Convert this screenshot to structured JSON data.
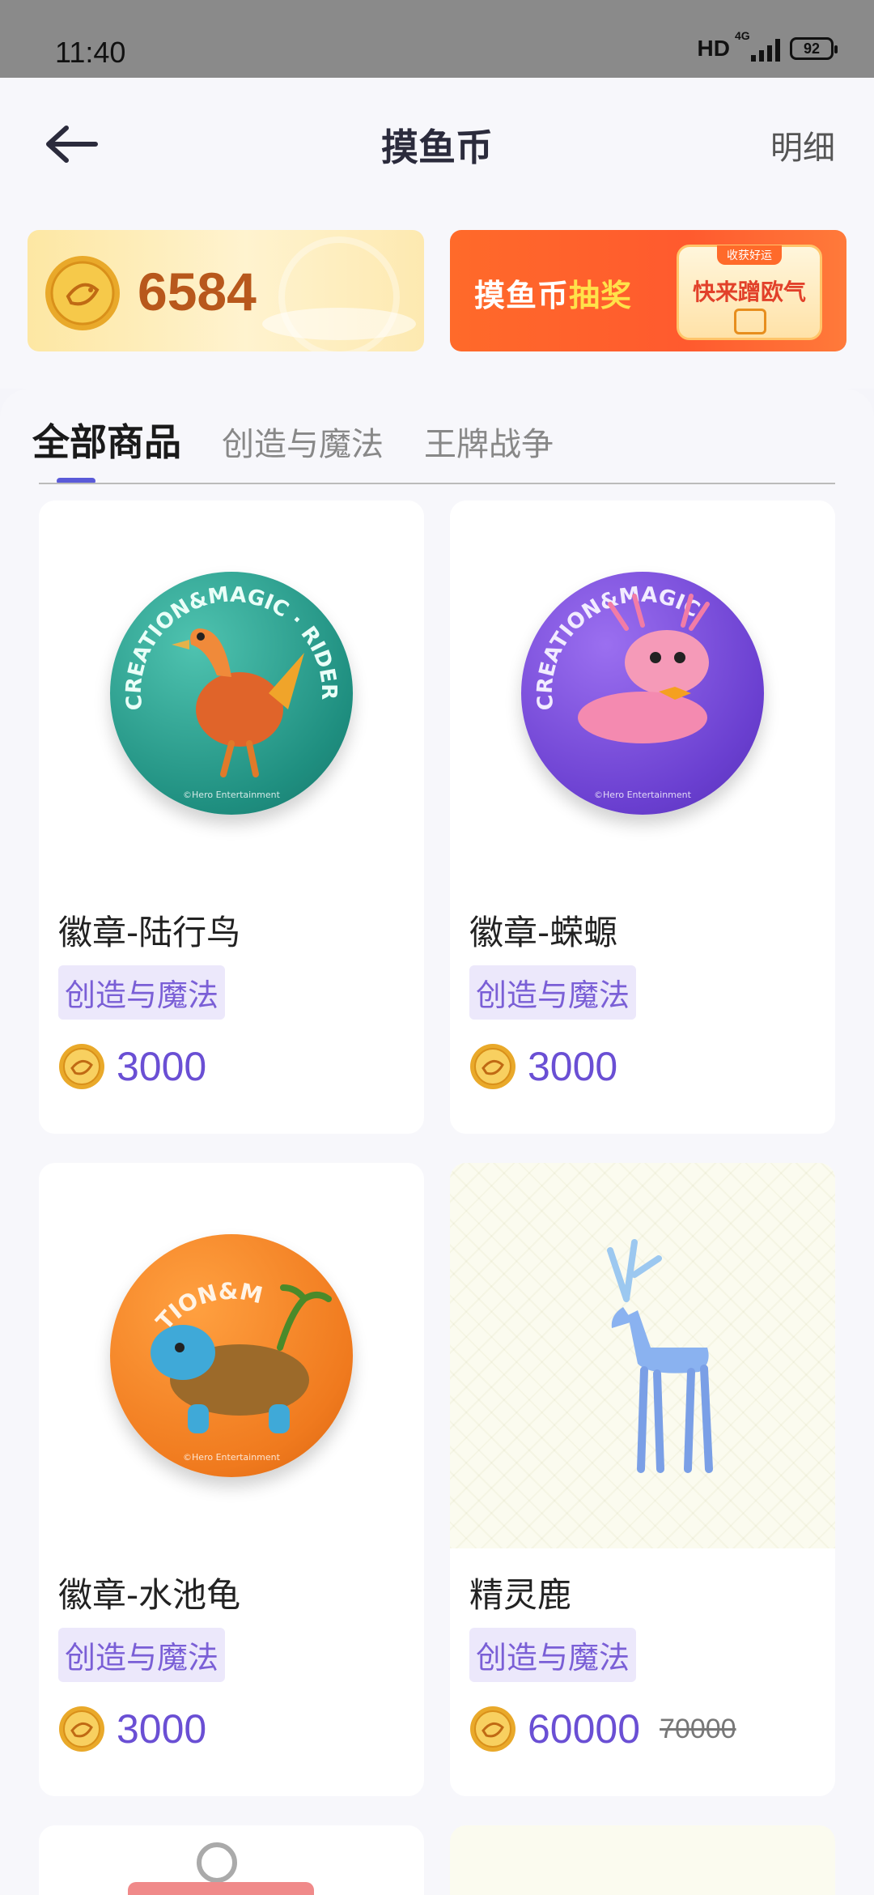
{
  "status_bar": {
    "time": "11:40",
    "hd": "HD",
    "network": "4G",
    "battery": "92"
  },
  "header": {
    "title": "摸鱼币",
    "detail_label": "明细"
  },
  "coin": {
    "balance": "6584"
  },
  "lottery": {
    "text_part1": "摸鱼币",
    "text_part2": "抽奖",
    "badge_top": "收获好运",
    "badge_main": "快来蹭欧气"
  },
  "tabs": [
    {
      "label": "全部商品",
      "active": true
    },
    {
      "label": "创造与魔法",
      "active": false
    },
    {
      "label": "王牌战争",
      "active": false
    }
  ],
  "products": [
    {
      "name": "徽章-陆行鸟",
      "tag": "创造与魔法",
      "price": "3000",
      "old_price": "",
      "ring_text": "CREATION&MAGIC · RIDER · HAWS",
      "copyright": "©Hero Entertainment",
      "color": "#2aa596"
    },
    {
      "name": "徽章-蝾螈",
      "tag": "创造与魔法",
      "price": "3000",
      "old_price": "",
      "ring_text": "CREATION&MAGIC",
      "copyright": "©Hero Entertainment",
      "color": "#7a4fd6"
    },
    {
      "name": "徽章-水池龟",
      "tag": "创造与魔法",
      "price": "3000",
      "old_price": "",
      "ring_text": "TION&M",
      "copyright": "©Hero Entertainment",
      "color": "#f07a1e"
    },
    {
      "name": "精灵鹿",
      "tag": "创造与魔法",
      "price": "60000",
      "old_price": "70000",
      "color": "#8ab2f0"
    }
  ]
}
